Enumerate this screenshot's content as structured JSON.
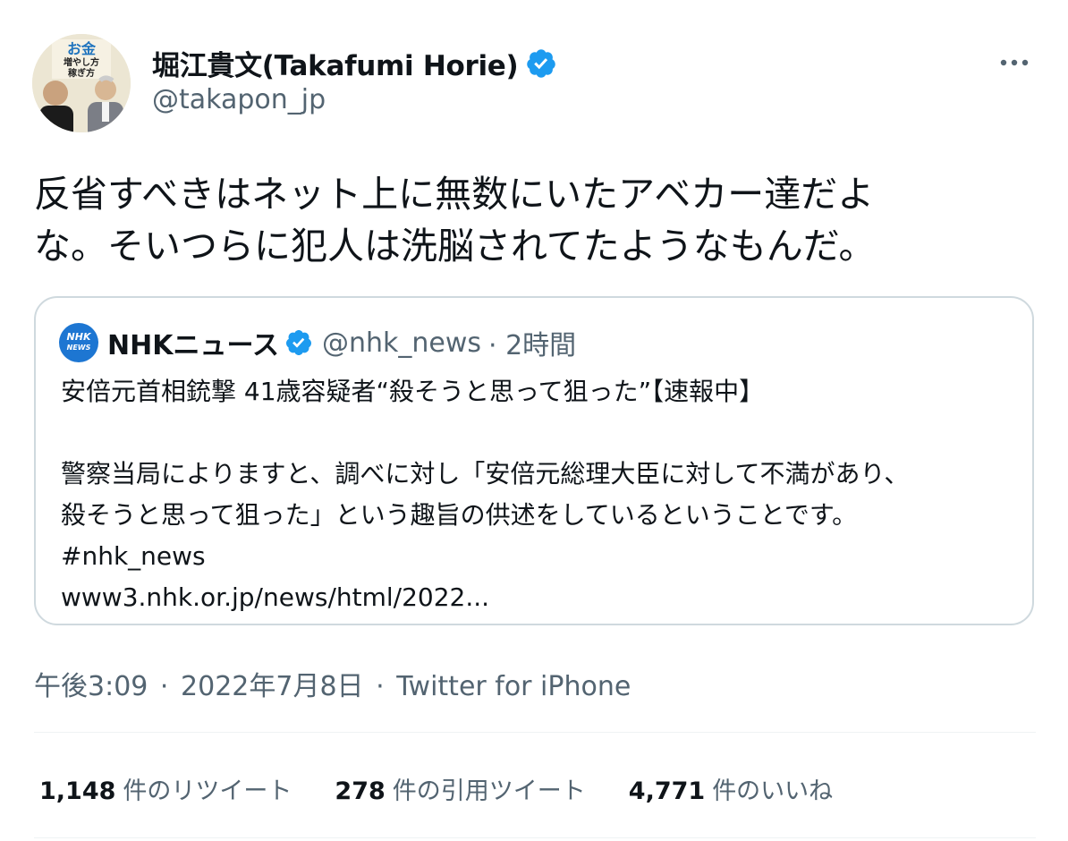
{
  "author": {
    "name": "堀江貴文(Takafumi Horie)",
    "handle": "@takapon_jp",
    "avatar_book_text": [
      "お金",
      "増やし方",
      "稼ぎ方"
    ]
  },
  "tweet": {
    "text_lines": [
      "反省すべきはネット上に無数にいたアベカー達だよ",
      "な。そいつらに犯人は洗脳されてたようなもんだ。"
    ]
  },
  "quote": {
    "logo_text": [
      "NHK",
      "NEWS"
    ],
    "name": "NHKニュース",
    "handle": "@nhk_news",
    "time": "· 2時間",
    "title": "安倍元首相銃撃 41歳容疑者“殺そうと思って狙った”【速報中】",
    "body_lines": [
      "警察当局によりますと、調べに対し「安倍元総理大臣に対して不満があり、",
      "殺そうと思って狙った」という趣旨の供述をしているということです。"
    ],
    "hashtag": "#nhk_news",
    "link": "www3.nhk.or.jp/news/html/2022..."
  },
  "timestamp": {
    "time": "午後3:09",
    "date": "2022年7月8日",
    "source": "Twitter for iPhone",
    "separator": "·"
  },
  "stats": [
    {
      "count": "1,148",
      "label": "件のリツイート"
    },
    {
      "count": "278",
      "label": "件の引用ツイート"
    },
    {
      "count": "4,771",
      "label": "件のいいね"
    }
  ],
  "colors": {
    "verified": "#1d9bf0",
    "secondary_text": "#536471",
    "nhk_logo": "#1d76d2"
  },
  "icons": [
    "verified-badge-icon",
    "more-options-icon"
  ]
}
